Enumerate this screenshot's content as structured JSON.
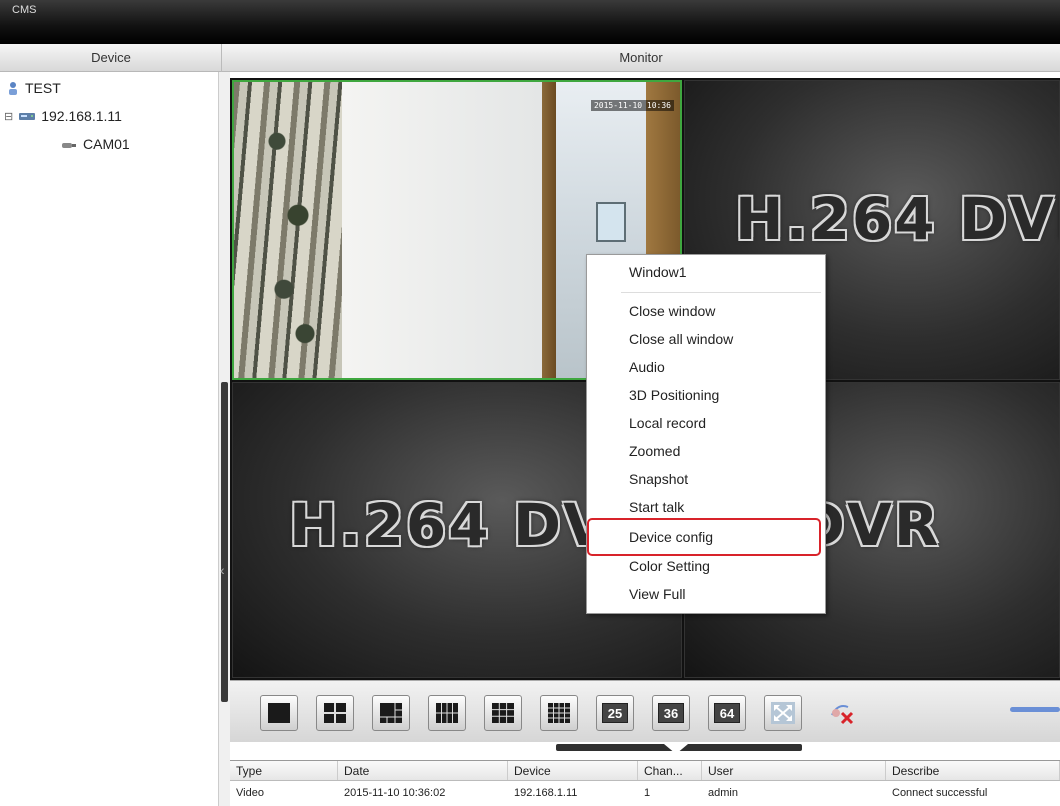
{
  "app": {
    "title": "CMS"
  },
  "header": {
    "device": "Device",
    "monitor": "Monitor"
  },
  "tree": [
    {
      "label": "TEST",
      "icon": "group-icon"
    },
    {
      "label": "192.168.1.11",
      "icon": "dvr-device-icon"
    },
    {
      "label": "CAM01",
      "icon": "camera-icon"
    }
  ],
  "video": {
    "watermark": "H.264 DVR",
    "osd": "2015-11-10 10:36"
  },
  "context_menu": {
    "items": [
      "Window1",
      "Close window",
      "Close all window",
      "Audio",
      "3D Positioning",
      "Local record",
      "Zoomed",
      "Snapshot",
      "Start talk",
      "Device config",
      "Color Setting",
      "View Full"
    ],
    "highlighted": "Device config"
  },
  "toolbar": {
    "layout_buttons": [
      "1-window",
      "4-window",
      "6-window",
      "8-window",
      "9-window",
      "16-window"
    ],
    "number_buttons": [
      "25",
      "36",
      "64"
    ]
  },
  "log": {
    "columns": [
      "Type",
      "Date",
      "Device",
      "Chan...",
      "User",
      "Describe"
    ],
    "rows": [
      [
        "Video",
        "2015-11-10 10:36:02",
        "192.168.1.11",
        "1",
        "admin",
        "Connect successful"
      ]
    ]
  },
  "colors": {
    "highlight_border": "#d8232a",
    "active_tile_border": "#3fa73f"
  }
}
